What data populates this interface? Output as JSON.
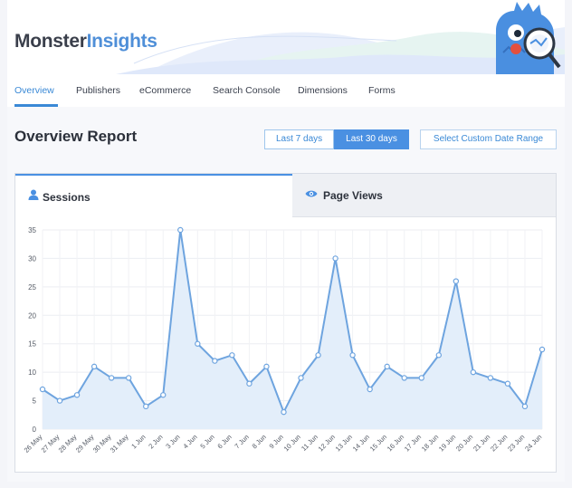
{
  "header": {
    "logo_part1": "Monster",
    "logo_part2": "Insights",
    "mascot_icon": "monster-mascot-icon",
    "colors": {
      "brand_dark": "#3a3f4b",
      "brand_blue": "#4f8fd8"
    }
  },
  "nav": {
    "tabs": [
      {
        "label": "Overview",
        "active": true
      },
      {
        "label": "Publishers"
      },
      {
        "label": "eCommerce"
      },
      {
        "label": "Search Console"
      },
      {
        "label": "Dimensions"
      },
      {
        "label": "Forms"
      }
    ]
  },
  "report": {
    "title": "Overview Report",
    "range_buttons": [
      {
        "label": "Last 7 days",
        "active": false
      },
      {
        "label": "Last 30 days",
        "active": true
      }
    ],
    "custom_range_label": "Select Custom Date Range",
    "tabs": {
      "sessions": {
        "label": "Sessions",
        "icon": "user-icon",
        "active": true
      },
      "pageviews": {
        "label": "Page Views",
        "icon": "eye-icon",
        "active": false
      }
    }
  },
  "chart_data": {
    "type": "area",
    "x": [
      "26 May",
      "27 May",
      "28 May",
      "29 May",
      "30 May",
      "31 May",
      "1 Jun",
      "2 Jun",
      "3 Jun",
      "4 Jun",
      "5 Jun",
      "6 Jun",
      "7 Jun",
      "8 Jun",
      "9 Jun",
      "10 Jun",
      "11 Jun",
      "12 Jun",
      "13 Jun",
      "14 Jun",
      "15 Jun",
      "16 Jun",
      "17 Jun",
      "18 Jun",
      "19 Jun",
      "20 Jun",
      "21 Jun",
      "22 Jun",
      "23 Jun",
      "24 Jun"
    ],
    "series": [
      {
        "values": [
          7,
          5,
          6,
          11,
          9,
          9,
          4,
          6,
          35,
          15,
          12,
          13,
          8,
          11,
          3,
          9,
          13,
          30,
          13,
          7,
          11,
          9,
          9,
          13,
          26,
          10,
          9,
          8,
          4,
          14
        ]
      }
    ],
    "yticks": [
      0,
      5,
      10,
      15,
      20,
      25,
      30,
      35
    ],
    "ylim": [
      0,
      35
    ],
    "grid": true,
    "line_color": "#6ea4df",
    "fill_color": "#e3eefa"
  }
}
